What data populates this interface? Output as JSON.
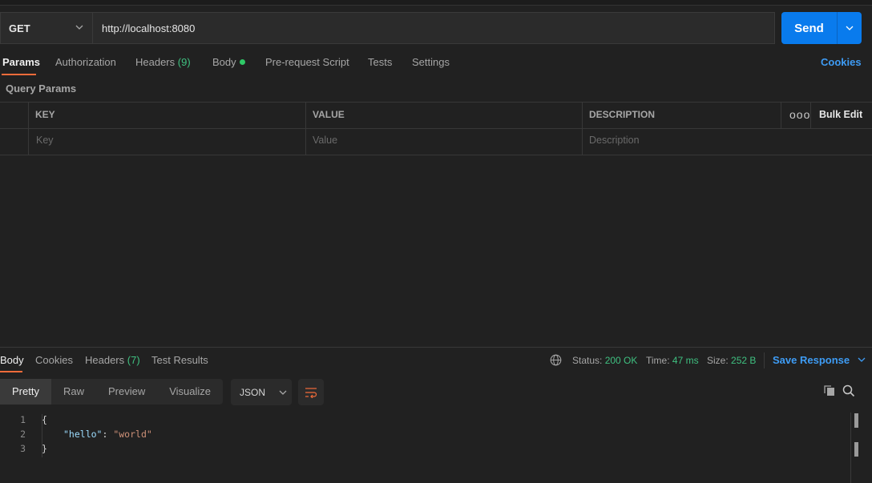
{
  "request": {
    "method": "GET",
    "url": "http://localhost:8080",
    "send_label": "Send"
  },
  "tabs": {
    "params": "Params",
    "authorization": "Authorization",
    "headers": "Headers",
    "headers_count": "(9)",
    "body": "Body",
    "pre_request": "Pre-request Script",
    "tests": "Tests",
    "settings": "Settings",
    "cookies": "Cookies"
  },
  "query_params": {
    "title": "Query Params",
    "columns": [
      "KEY",
      "VALUE",
      "DESCRIPTION"
    ],
    "placeholders": [
      "Key",
      "Value",
      "Description"
    ],
    "bulk_edit": "Bulk Edit",
    "more": "ooo"
  },
  "response": {
    "tabs": {
      "body": "Body",
      "cookies": "Cookies",
      "headers": "Headers",
      "headers_count": "(7)",
      "test_results": "Test Results"
    },
    "status_label": "Status:",
    "status_value": "200 OK",
    "time_label": "Time:",
    "time_value": "47 ms",
    "size_label": "Size:",
    "size_value": "252 B",
    "save_label": "Save Response",
    "views": [
      "Pretty",
      "Raw",
      "Preview",
      "Visualize"
    ],
    "active_view": "Pretty",
    "format": "JSON",
    "line_numbers": [
      "1",
      "2",
      "3"
    ],
    "code": {
      "open": "{",
      "key": "\"hello\"",
      "colon": ": ",
      "value": "\"world\"",
      "close": "}"
    }
  },
  "colors": {
    "accent": "#f26b3a",
    "primary_blue": "#097bed",
    "success_green": "#3fc080",
    "link_blue": "#3e9cf5"
  },
  "icons": [
    "chevron-down-icon",
    "globe-icon",
    "copy-icon",
    "search-icon",
    "wrap-lines-icon"
  ]
}
